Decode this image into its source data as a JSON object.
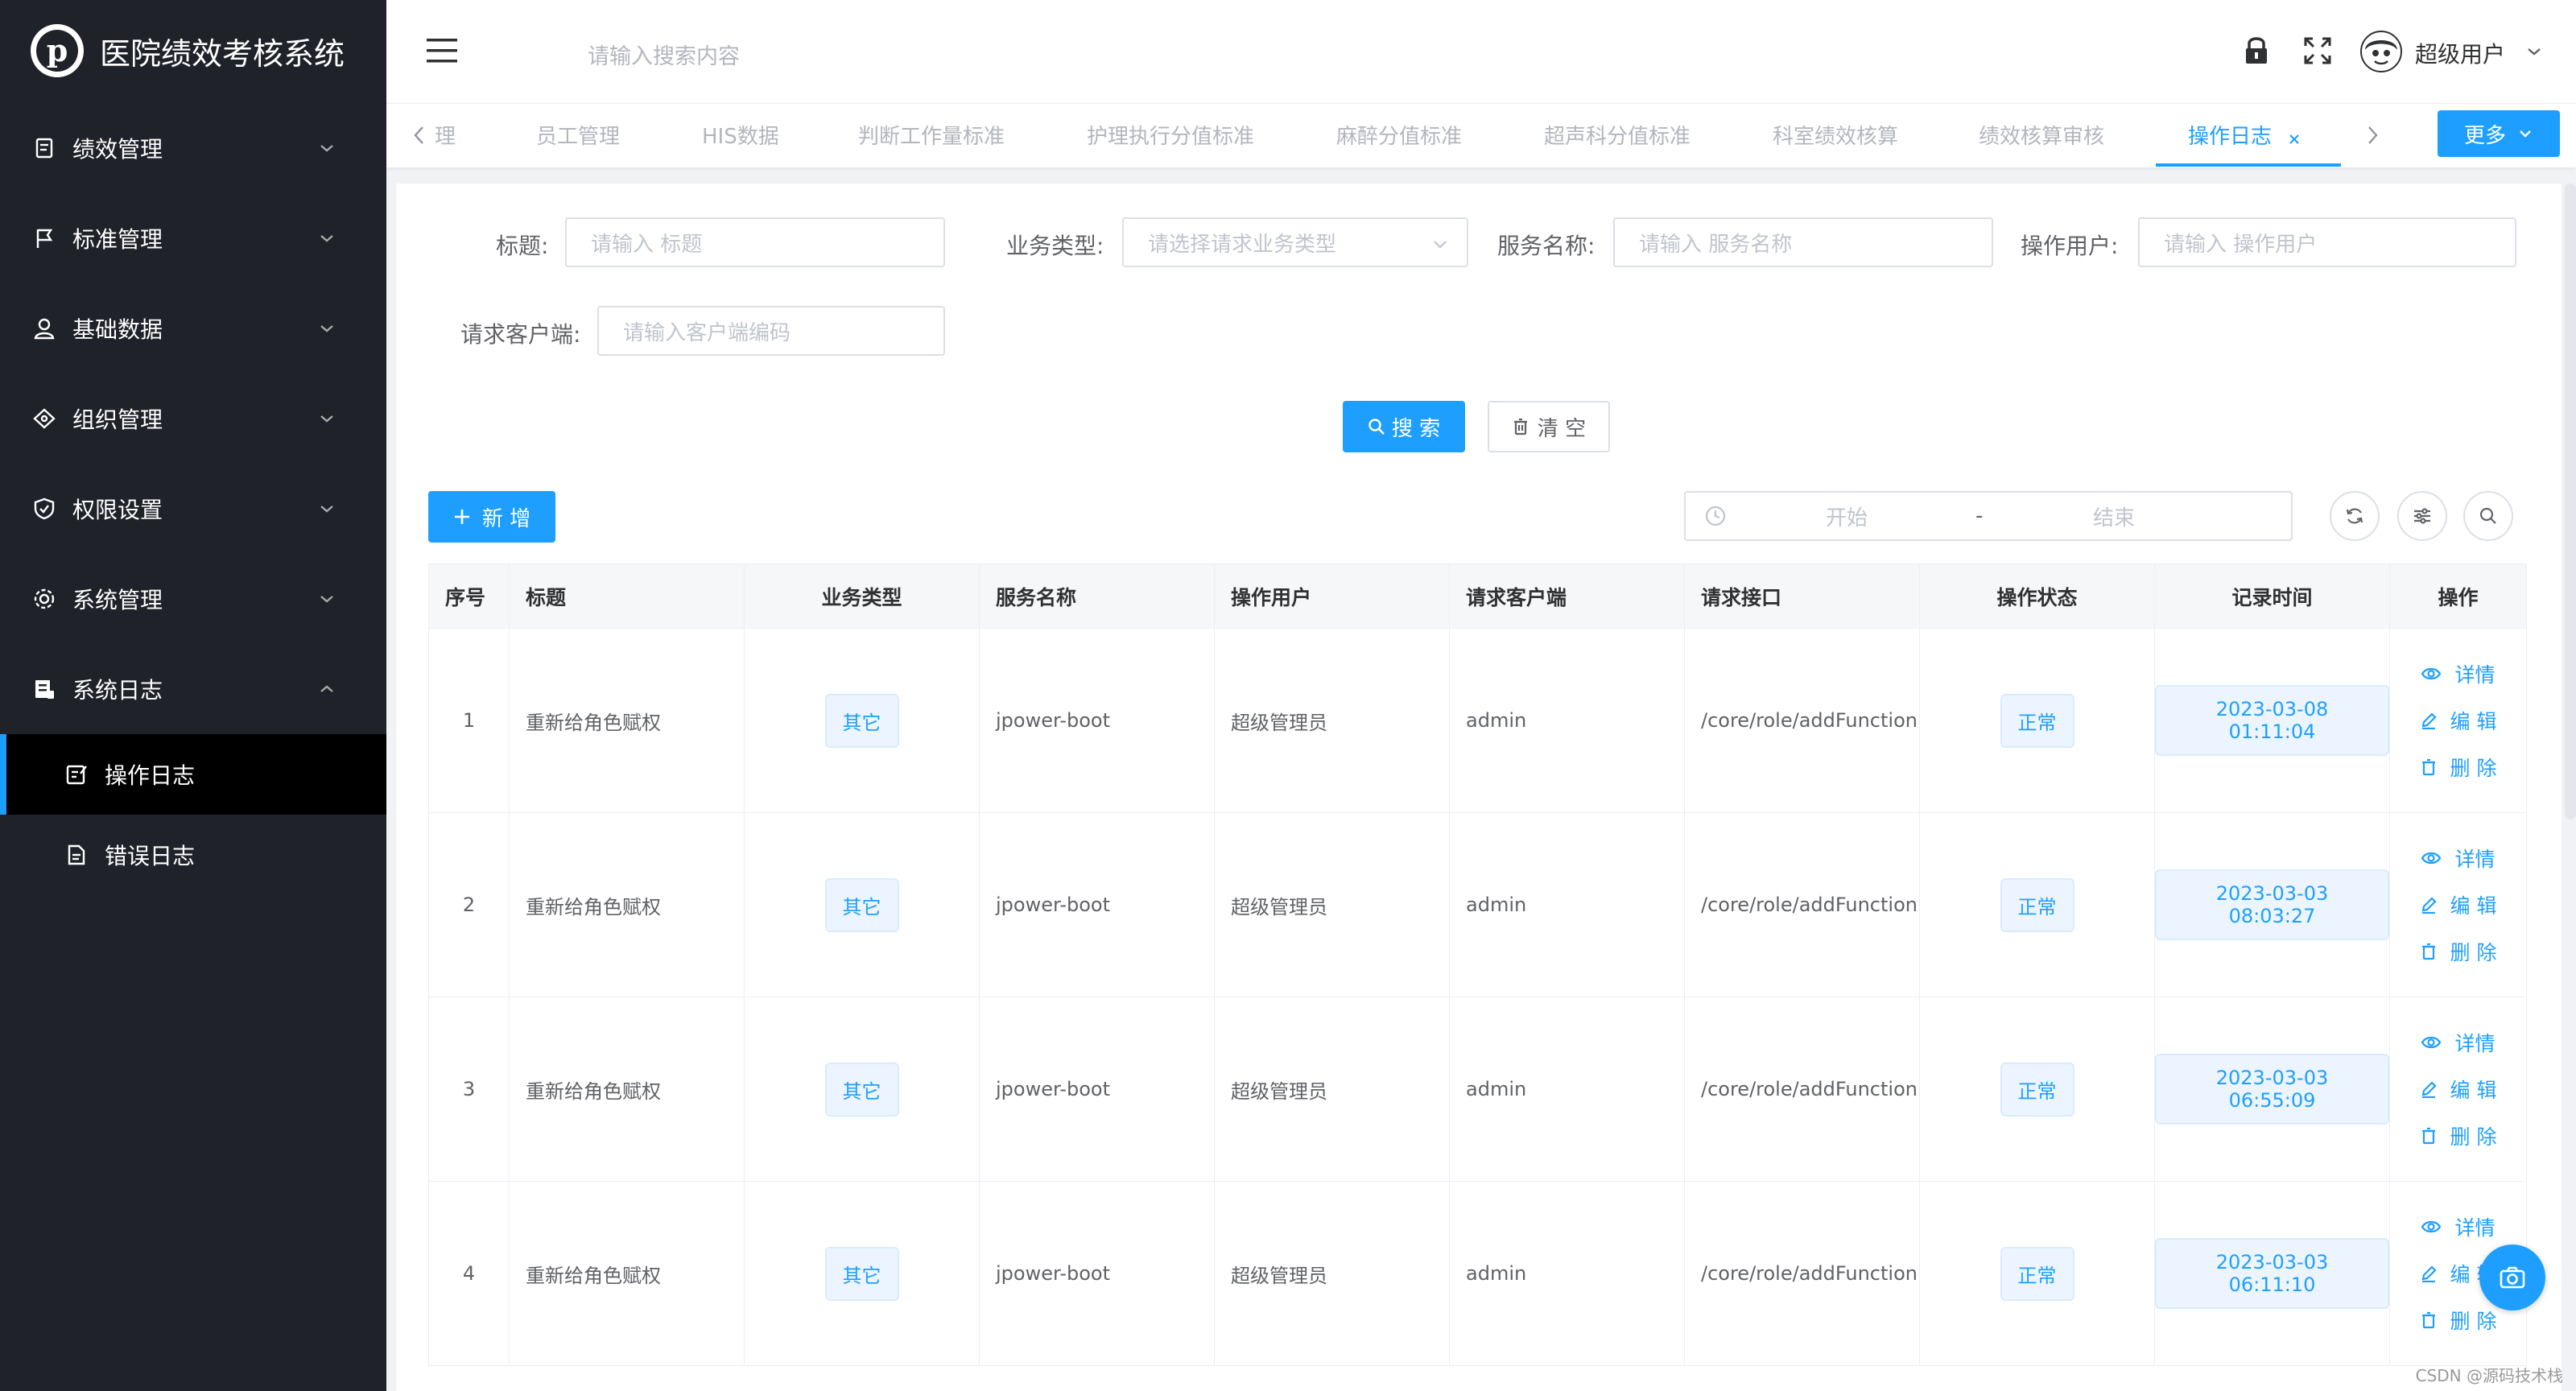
{
  "app": {
    "title": "医院绩效考核系统"
  },
  "sidebar": {
    "items": [
      {
        "label": "绩效管理",
        "icon": "document-icon"
      },
      {
        "label": "标准管理",
        "icon": "flag-icon"
      },
      {
        "label": "基础数据",
        "icon": "user-icon"
      },
      {
        "label": "组织管理",
        "icon": "diamond-icon"
      },
      {
        "label": "权限设置",
        "icon": "shield-icon"
      },
      {
        "label": "系统管理",
        "icon": "gear-icon"
      },
      {
        "label": "系统日志",
        "icon": "log-icon"
      }
    ],
    "sub_items": [
      {
        "label": "操作日志",
        "active": true
      },
      {
        "label": "错误日志",
        "active": false
      }
    ]
  },
  "header": {
    "search_placeholder": "请输入搜索内容",
    "user_name": "超级用户"
  },
  "tabs": {
    "items": [
      "理",
      "员工管理",
      "HIS数据",
      "判断工作量标准",
      "护理执行分值标准",
      "麻醉分值标准",
      "超声科分值标准",
      "科室绩效核算",
      "绩效核算审核",
      "操作日志"
    ],
    "active": "操作日志",
    "more_label": "更多"
  },
  "filters": {
    "title_label": "标题:",
    "title_placeholder": "请输入 标题",
    "biz_label": "业务类型:",
    "biz_placeholder": "请选择请求业务类型",
    "service_label": "服务名称:",
    "service_placeholder": "请输入 服务名称",
    "user_label": "操作用户:",
    "user_placeholder": "请输入 操作用户",
    "client_label": "请求客户端:",
    "client_placeholder": "请输入客户端编码",
    "search_btn": "搜 索",
    "clear_btn": "清 空"
  },
  "toolbar": {
    "add_btn": "新 增",
    "date_start": "开始",
    "date_sep": "-",
    "date_end": "结束"
  },
  "table": {
    "headers": [
      "序号",
      "标题",
      "业务类型",
      "服务名称",
      "操作用户",
      "请求客户端",
      "请求接口",
      "操作状态",
      "记录时间",
      "操作"
    ],
    "rows": [
      {
        "no": "1",
        "title": "重新给角色赋权",
        "biz": "其它",
        "service": "jpower-boot",
        "user": "超级管理员",
        "client": "admin",
        "api": "/core/role/addFunction",
        "status": "正常",
        "time": "2023-03-08 01:11:04"
      },
      {
        "no": "2",
        "title": "重新给角色赋权",
        "biz": "其它",
        "service": "jpower-boot",
        "user": "超级管理员",
        "client": "admin",
        "api": "/core/role/addFunction",
        "status": "正常",
        "time": "2023-03-03 08:03:27"
      },
      {
        "no": "3",
        "title": "重新给角色赋权",
        "biz": "其它",
        "service": "jpower-boot",
        "user": "超级管理员",
        "client": "admin",
        "api": "/core/role/addFunction",
        "status": "正常",
        "time": "2023-03-03 06:55:09"
      },
      {
        "no": "4",
        "title": "重新给角色赋权",
        "biz": "其它",
        "service": "jpower-boot",
        "user": "超级管理员",
        "client": "admin",
        "api": "/core/role/addFunction",
        "status": "正常",
        "time": "2023-03-03 06:11:10"
      }
    ],
    "row_actions": [
      "详情",
      "编 辑",
      "删 除"
    ]
  },
  "watermark": "CSDN @源码技术栈",
  "colors": {
    "accent": "#1e9fff",
    "sidebar": "#20222a"
  }
}
